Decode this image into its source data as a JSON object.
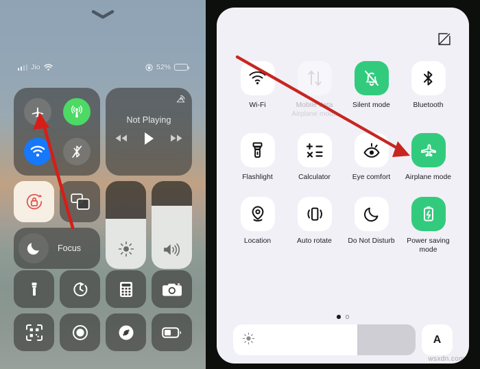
{
  "ios": {
    "grabber": "chevron-down-handle",
    "status": {
      "carrier": "Jio",
      "wifi_icon": "wifi-icon",
      "signal_icon": "cellular-signal-icon",
      "orientation_lock_icon": "rotation-lock-status-icon",
      "battery_percent": "52%",
      "battery_level": 52
    },
    "connectivity": {
      "airplane": {
        "name": "airplane-mode",
        "state": "off"
      },
      "cellular": {
        "name": "cellular-data",
        "state": "on"
      },
      "wifi": {
        "name": "wifi",
        "state": "on"
      },
      "bluetooth": {
        "name": "bluetooth",
        "state": "off"
      }
    },
    "media": {
      "title": "Not Playing",
      "airplay_icon": "airplay-icon",
      "prev_label": "rewind",
      "play_label": "play",
      "next_label": "fast-forward"
    },
    "rotation_lock": {
      "label": "rotation-lock",
      "state": "on"
    },
    "screen_mirroring": {
      "label": "screen-mirroring",
      "state": "off"
    },
    "focus": {
      "label": "Focus",
      "state": "off"
    },
    "brightness": {
      "label": "brightness",
      "value": 57
    },
    "volume": {
      "label": "volume",
      "value": 72
    },
    "shortcuts": [
      {
        "name": "flashlight",
        "icon": "flashlight-icon"
      },
      {
        "name": "timer",
        "icon": "timer-icon"
      },
      {
        "name": "calculator",
        "icon": "calculator-icon"
      },
      {
        "name": "camera",
        "icon": "camera-icon"
      },
      {
        "name": "code-scanner",
        "icon": "qr-scanner-icon"
      },
      {
        "name": "screen-recording",
        "icon": "record-icon"
      },
      {
        "name": "shazam",
        "icon": "shazam-icon"
      },
      {
        "name": "low-power-mode",
        "icon": "battery-low-power-icon"
      }
    ]
  },
  "android": {
    "edit_label": "Edit",
    "tiles": [
      {
        "label": "Wi-Fi",
        "icon": "wifi-icon",
        "state": "off",
        "caret": true
      },
      {
        "label": "Mobile data",
        "icon": "mobile-data-icon",
        "state": "disabled",
        "caret": false,
        "sublabel": "Airplane mode"
      },
      {
        "label": "Silent mode",
        "icon": "bell-muted-icon",
        "state": "on",
        "caret": false
      },
      {
        "label": "Bluetooth",
        "icon": "bluetooth-icon",
        "state": "off",
        "caret": true
      },
      {
        "label": "Flashlight",
        "icon": "flashlight-icon",
        "state": "off",
        "caret": false
      },
      {
        "label": "Calculator",
        "icon": "calculator-icon",
        "state": "off",
        "caret": false
      },
      {
        "label": "Eye comfort",
        "icon": "eye-comfort-icon",
        "state": "off",
        "caret": false
      },
      {
        "label": "Airplane mode",
        "icon": "airplane-icon",
        "state": "on",
        "caret": false
      },
      {
        "label": "Location",
        "icon": "location-pin-icon",
        "state": "off",
        "caret": false
      },
      {
        "label": "Auto rotate",
        "icon": "auto-rotate-icon",
        "state": "off",
        "caret": false
      },
      {
        "label": "Do Not Disturb",
        "icon": "moon-icon",
        "state": "off",
        "caret": true
      },
      {
        "label": "Power saving mode",
        "icon": "battery-saver-icon",
        "state": "on",
        "caret": false
      }
    ],
    "pager": {
      "pages": 2,
      "current": 1
    },
    "brightness": {
      "icon": "brightness-icon",
      "value": 68
    },
    "auto_brightness": {
      "label": "A",
      "state": "off"
    },
    "watermark": "wsxdn.com"
  },
  "annotations": {
    "arrow_left": {
      "name": "arrow-pointing-to-ios-airplane-toggle",
      "color": "#d61e18"
    },
    "arrow_right": {
      "name": "arrow-pointing-to-android-airplane-tile",
      "color": "#c72620"
    }
  },
  "colors": {
    "android_accent_green": "#32cb7e",
    "ios_green": "#4cd964",
    "ios_blue": "#1678fb",
    "arrow_red": "#d61e18",
    "panel_bg": "#f1f0f6"
  }
}
